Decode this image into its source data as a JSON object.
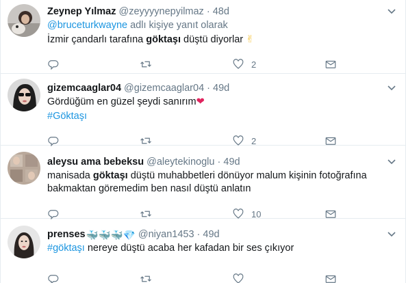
{
  "tweets": [
    {
      "name": "Zeynep Yılmaz",
      "handle": "@zeyyyynepyilmaz",
      "time": "48d",
      "reply_to_mention": "@bruceturkwayne",
      "reply_to_text": " adlı kişiye yanıt olarak",
      "text_before": "İzmir çandarlı tarafına ",
      "text_bold": "göktaşı",
      "text_after": " düştü diyorlar ",
      "trailing_emoji": "✌",
      "like_count": "2"
    },
    {
      "name": "gizemcaaglar04",
      "handle": "@gizemcaaglar04",
      "time": "49d",
      "text": "Gördüğüm en güzel şeydi sanırım",
      "trailing_emoji": "❤",
      "hashtag": "#Göktaşı",
      "like_count": "2"
    },
    {
      "name": "aleysu ama bebeksu",
      "handle": "@aleytekinoglu",
      "time": "49d",
      "text_before": "manisada ",
      "text_bold": "göktaşı",
      "text_after": " düştü muhabbetleri dönüyor malum kişinin fotoğrafına bakmaktan göremedim ben nasıl düştü anlatın",
      "like_count": "10"
    },
    {
      "name": "prenses",
      "name_emoji": "🐳🐳🐳💎",
      "handle": "@niyan1453",
      "time": "49d",
      "hashtag": "#göktaşı",
      "text_after": " nereye düştü acaba her kafadan bir ses çıkıyor",
      "like_count": ""
    }
  ],
  "icons": {
    "reply": "reply-icon",
    "retweet": "retweet-icon",
    "like": "heart-icon",
    "dm": "envelope-icon",
    "more": "chevron-down-icon"
  },
  "colors": {
    "link": "#1b95e0",
    "secondary_text": "#657786",
    "divider": "#e6ecf0",
    "heart_emoji": "#e0245e"
  }
}
